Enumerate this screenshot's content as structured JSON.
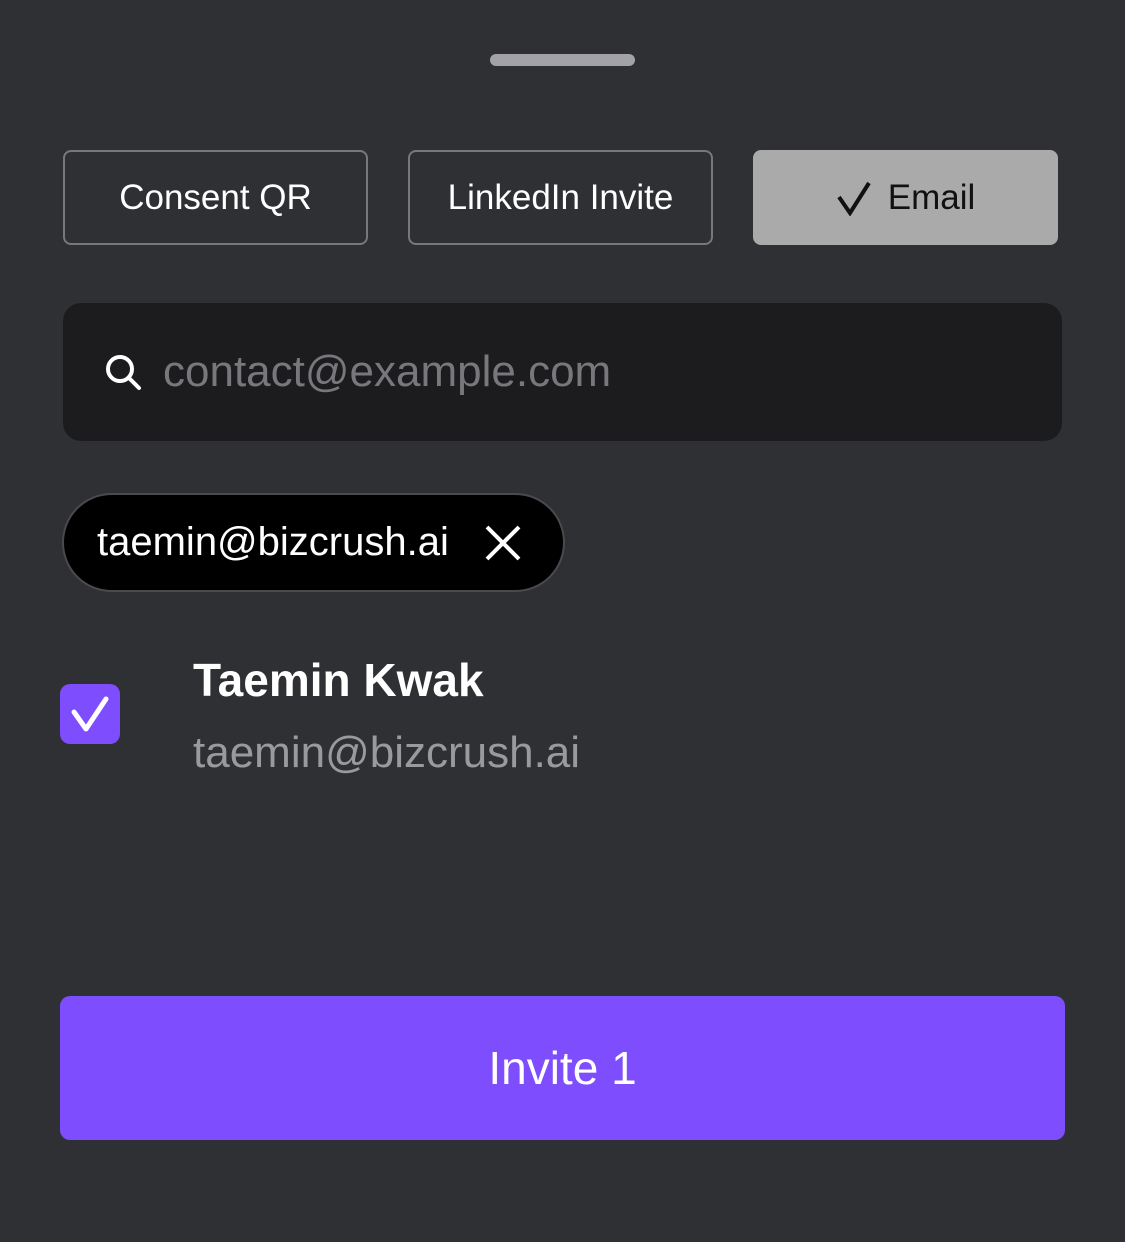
{
  "tabs": {
    "consent_qr": "Consent QR",
    "linkedin_invite": "LinkedIn Invite",
    "email": "Email",
    "selected": "email",
    "selected_icon": "checkmark-icon"
  },
  "search": {
    "placeholder": "contact@example.com",
    "value": "",
    "icon": "search-icon"
  },
  "chips": [
    {
      "label": "taemin@bizcrush.ai",
      "remove_icon": "close-icon"
    }
  ],
  "contacts": [
    {
      "name": "Taemin Kwak",
      "email": "taemin@bizcrush.ai",
      "checked": true
    }
  ],
  "invite_button": {
    "label": "Invite 1"
  },
  "colors": {
    "background": "#2f3034",
    "accent": "#7d4dfe",
    "selected_tab": "#aaaaaa",
    "input_background": "#1c1c1e",
    "secondary_text": "#9a9a9e"
  }
}
